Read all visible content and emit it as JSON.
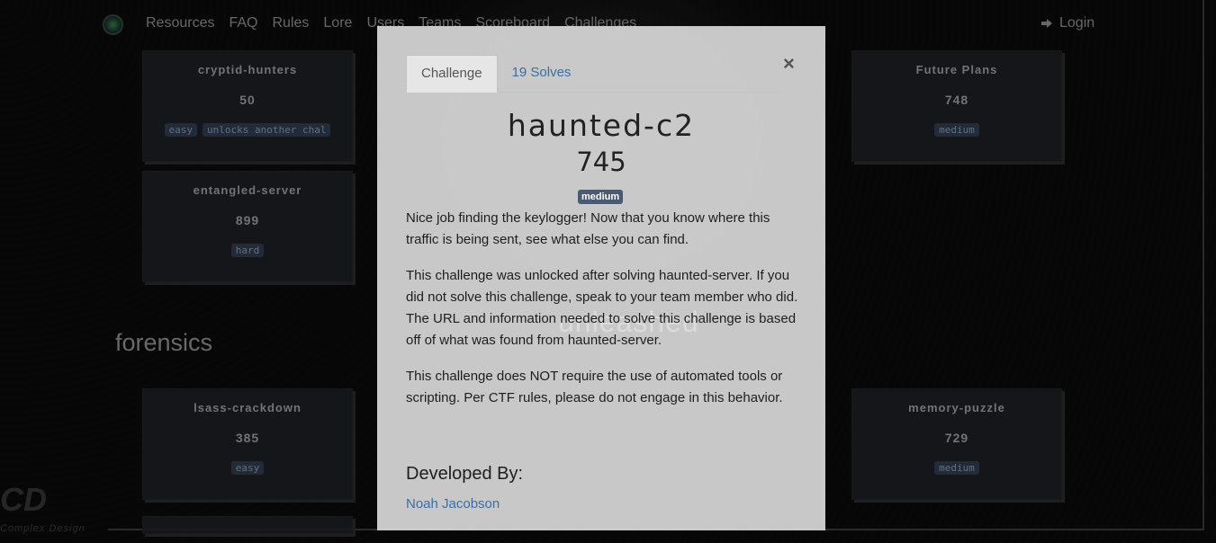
{
  "nav": {
    "links": [
      "Resources",
      "FAQ",
      "Rules",
      "Lore",
      "Users",
      "Teams",
      "Scoreboard",
      "Challenges"
    ],
    "login": "Login"
  },
  "cards": [
    {
      "name": "cryptid-hunters",
      "points": "50",
      "tags": [
        "easy",
        "unlocks another chal"
      ]
    },
    {
      "name": "Future Plans",
      "points": "748",
      "tags": [
        "medium"
      ]
    },
    {
      "name": "entangled-server",
      "points": "899",
      "tags": [
        "hard"
      ]
    },
    {
      "name": "lsass-crackdown",
      "points": "385",
      "tags": [
        "easy"
      ]
    },
    {
      "name": "memory-puzzle",
      "points": "729",
      "tags": [
        "medium"
      ]
    }
  ],
  "section": {
    "title": "forensics"
  },
  "modal": {
    "tabs": [
      "Challenge",
      "19 Solves"
    ],
    "close": "×",
    "title": "haunted-c2",
    "points": "745",
    "tag": "medium",
    "paragraphs": [
      "Nice job finding the keylogger! Now that you know where this traffic is being sent, see what else you can find.",
      "This challenge was unlocked after solving haunted-server. If you did not solve this challenge, speak to your team member who did. The URL and information needed to solve this challenge is based off of what was found from haunted-server.",
      "This challenge does NOT require the use of automated tools or scripting. Per CTF rules, please do not engage in this behavior."
    ],
    "developed_by": "Developed By:",
    "developer": "Noah Jacobson"
  },
  "background_text": "unleashed"
}
